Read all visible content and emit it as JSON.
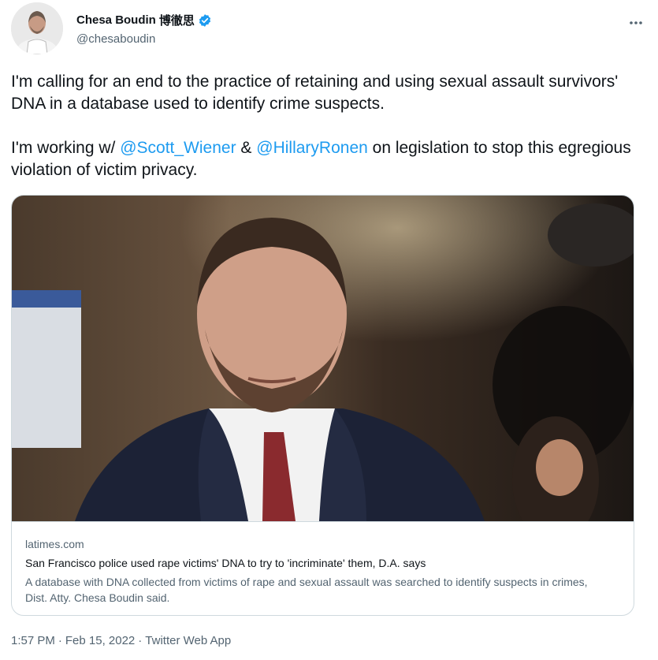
{
  "author": {
    "name": "Chesa Boudin",
    "name_cn": "博徹思",
    "handle": "@chesaboudin",
    "verified": true
  },
  "tweet": {
    "line1": "I'm calling for an end to the practice of retaining and using sexual assault survivors' DNA in a database used to identify crime suspects.",
    "line2_prefix": "I'm working w/ ",
    "mention1": "@Scott_Wiener",
    "and": " & ",
    "mention2": "@HillaryRonen",
    "line2_suffix": " on legislation to stop this egregious violation of victim privacy."
  },
  "card": {
    "domain": "latimes.com",
    "title": "San Francisco police used rape victims' DNA to try to 'incriminate' them, D.A. says",
    "description": "A database with DNA collected from victims of rape and sexual assault was searched to identify suspects in crimes, Dist. Atty. Chesa Boudin said."
  },
  "meta": {
    "time": "1:57 PM",
    "sep1": "·",
    "date": "Feb 15, 2022",
    "sep2": "·",
    "source": "Twitter Web App"
  },
  "icons": {
    "verified": "verified-badge-icon",
    "more": "more-horizontal-icon"
  },
  "colors": {
    "link": "#1d9bf0",
    "secondary": "#536471",
    "text": "#0f1419",
    "border": "#cfd9de"
  }
}
